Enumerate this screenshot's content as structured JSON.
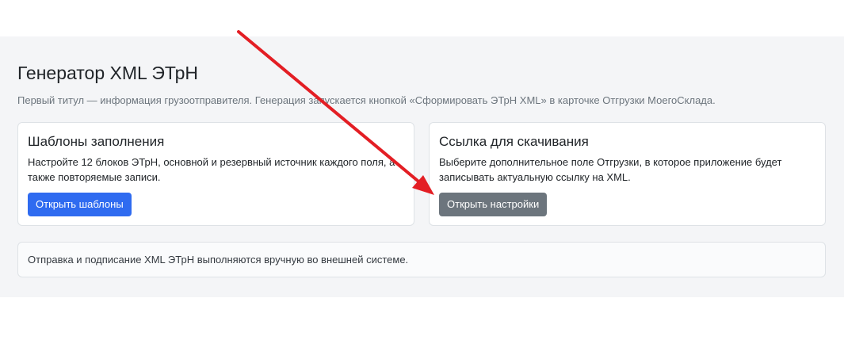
{
  "page": {
    "title": "Генератор XML ЭТрН",
    "subtitle": "Первый титул — информация грузоотправителя. Генерация запускается кнопкой «Сформировать ЭТрН XML» в карточке Отгрузки МоегоСклада."
  },
  "cards": {
    "templates": {
      "title": "Шаблоны заполнения",
      "text": "Настройте 12 блоков ЭТрН, основной и резервный источник каждого поля, а также повторяемые записи.",
      "button_label": "Открыть шаблоны"
    },
    "link": {
      "title": "Ссылка для скачивания",
      "text": "Выберите дополнительное поле Отгрузки, в которое приложение будет записывать актуальную ссылку на XML.",
      "button_label": "Открыть настройки"
    }
  },
  "note": {
    "text": "Отправка и подписание XML ЭТрН выполняются вручную во внешней системе."
  },
  "colors": {
    "panel_background": "#f4f5f7",
    "primary_button": "#2f6bf0",
    "secondary_button": "#6c757d",
    "annotation_arrow": "#e31e24"
  }
}
